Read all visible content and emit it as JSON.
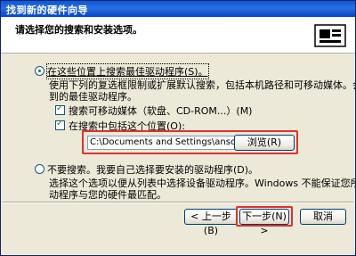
{
  "window": {
    "title": "找到新的硬件向导"
  },
  "header": {
    "text": "请选择您的搜索和安装选项。"
  },
  "option_search": {
    "label": "在这些位置上搜索最佳驱动程序(S)。",
    "description_line1": "使用下列的复选框限制或扩展默认搜索，包括本机路径和可移动媒体。会安装找",
    "description_line2": "到的最佳驱动程序。",
    "removable_media_label": "搜索可移动媒体（软盘、CD-ROM...）(M)",
    "include_location_label": "在搜索中包括这个位置(O):",
    "location_value": "C:\\Documents and Settings\\ansonyang\\桌面\\x",
    "browse_label": "浏览(R)"
  },
  "option_manual": {
    "label": "不要搜索。我要自己选择要安装的驱动程序(D)。",
    "description_line1": "选择这个选项以便从列表中选择设备驱动程序。Windows 不能保证您所选择的驱",
    "description_line2": "动程序与您的硬件最匹配。"
  },
  "buttons": {
    "back": "< 上一步(B)",
    "next": "下一步(N) >",
    "cancel": "取消"
  },
  "colors": {
    "highlight": "#e0312f",
    "title_bar": "#0a58d6"
  }
}
